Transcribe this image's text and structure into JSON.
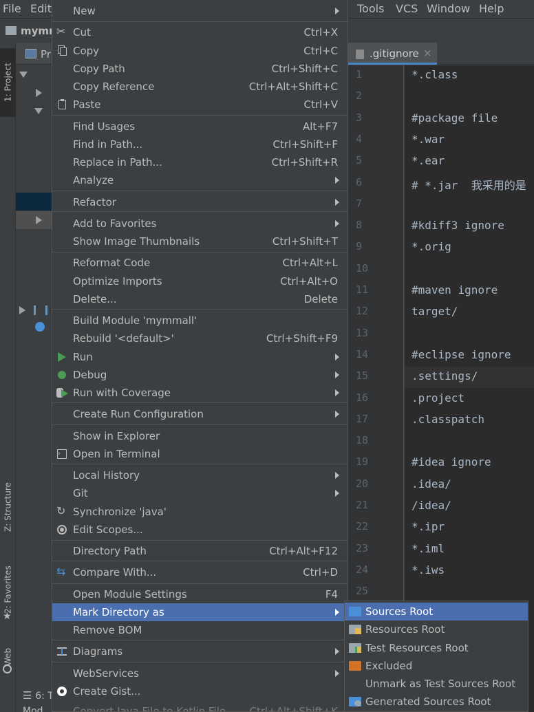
{
  "menubar": {
    "file": "File",
    "edit": "Edit",
    "tools": "Tools",
    "vcs": "VCS",
    "window": "Window",
    "help": "Help"
  },
  "navbar": {
    "project_name": "mymr"
  },
  "toolstrip": {
    "project": "1: Project",
    "structure": "Z: Structure",
    "favorites": "2: Favorites",
    "web": "Web"
  },
  "project_panel": {
    "title": "Pr"
  },
  "bottom": {
    "tab": "6: T",
    "cut_label": "Mod"
  },
  "editor": {
    "tab": ".gitignore",
    "tab_close": "×",
    "current_line": 15,
    "lines": [
      {
        "n": "1",
        "t": "*.class"
      },
      {
        "n": "2",
        "t": ""
      },
      {
        "n": "3",
        "t": "#package file"
      },
      {
        "n": "4",
        "t": "*.war"
      },
      {
        "n": "5",
        "t": "*.ear"
      },
      {
        "n": "6",
        "t": "# *.jar  我采用的是"
      },
      {
        "n": "7",
        "t": ""
      },
      {
        "n": "8",
        "t": "#kdiff3 ignore"
      },
      {
        "n": "9",
        "t": "*.orig"
      },
      {
        "n": "10",
        "t": ""
      },
      {
        "n": "11",
        "t": "#maven ignore"
      },
      {
        "n": "12",
        "t": "target/"
      },
      {
        "n": "13",
        "t": ""
      },
      {
        "n": "14",
        "t": "#eclipse ignore"
      },
      {
        "n": "15",
        "t": ".settings/"
      },
      {
        "n": "16",
        "t": ".project"
      },
      {
        "n": "17",
        "t": ".classpatch"
      },
      {
        "n": "18",
        "t": ""
      },
      {
        "n": "19",
        "t": "#idea ignore"
      },
      {
        "n": "20",
        "t": ".idea/"
      },
      {
        "n": "21",
        "t": "/idea/"
      },
      {
        "n": "22",
        "t": "*.ipr"
      },
      {
        "n": "23",
        "t": "*.iml"
      },
      {
        "n": "24",
        "t": "*.iws"
      },
      {
        "n": "25",
        "t": ""
      }
    ]
  },
  "context_menu": {
    "items": [
      {
        "label": "New",
        "shortcut": "",
        "submenu": true
      },
      {
        "label": "Cut",
        "shortcut": "Ctrl+X"
      },
      {
        "label": "Copy",
        "shortcut": "Ctrl+C"
      },
      {
        "label": "Copy Path",
        "shortcut": "Ctrl+Shift+C"
      },
      {
        "label": "Copy Reference",
        "shortcut": "Ctrl+Alt+Shift+C"
      },
      {
        "label": "Paste",
        "shortcut": "Ctrl+V"
      },
      {
        "label": "Find Usages",
        "shortcut": "Alt+F7"
      },
      {
        "label": "Find in Path...",
        "shortcut": "Ctrl+Shift+F"
      },
      {
        "label": "Replace in Path...",
        "shortcut": "Ctrl+Shift+R"
      },
      {
        "label": "Analyze",
        "shortcut": "",
        "submenu": true
      },
      {
        "label": "Refactor",
        "shortcut": "",
        "submenu": true
      },
      {
        "label": "Add to Favorites",
        "shortcut": "",
        "submenu": true
      },
      {
        "label": "Show Image Thumbnails",
        "shortcut": "Ctrl+Shift+T"
      },
      {
        "label": "Reformat Code",
        "shortcut": "Ctrl+Alt+L"
      },
      {
        "label": "Optimize Imports",
        "shortcut": "Ctrl+Alt+O"
      },
      {
        "label": "Delete...",
        "shortcut": "Delete"
      },
      {
        "label": "Build Module 'mymmall'",
        "shortcut": ""
      },
      {
        "label": "Rebuild '<default>'",
        "shortcut": "Ctrl+Shift+F9"
      },
      {
        "label": "Run",
        "shortcut": "",
        "submenu": true
      },
      {
        "label": "Debug",
        "shortcut": "",
        "submenu": true
      },
      {
        "label": "Run with Coverage",
        "shortcut": "",
        "submenu": true
      },
      {
        "label": "Create Run Configuration",
        "shortcut": "",
        "submenu": true
      },
      {
        "label": "Show in Explorer",
        "shortcut": ""
      },
      {
        "label": "Open in Terminal",
        "shortcut": ""
      },
      {
        "label": "Local History",
        "shortcut": "",
        "submenu": true
      },
      {
        "label": "Git",
        "shortcut": "",
        "submenu": true
      },
      {
        "label": "Synchronize 'java'",
        "shortcut": ""
      },
      {
        "label": "Edit Scopes...",
        "shortcut": ""
      },
      {
        "label": "Directory Path",
        "shortcut": "Ctrl+Alt+F12"
      },
      {
        "label": "Compare With...",
        "shortcut": "Ctrl+D"
      },
      {
        "label": "Open Module Settings",
        "shortcut": "F4"
      },
      {
        "label": "Mark Directory as",
        "shortcut": "",
        "submenu": true
      },
      {
        "label": "Remove BOM",
        "shortcut": ""
      },
      {
        "label": "Diagrams",
        "shortcut": "",
        "submenu": true
      },
      {
        "label": "WebServices",
        "shortcut": "",
        "submenu": true
      },
      {
        "label": "Create Gist...",
        "shortcut": ""
      },
      {
        "label": "Convert Java File to Kotlin File",
        "shortcut": "Ctrl+Alt+Shift+K"
      }
    ]
  },
  "submenu": {
    "items": [
      {
        "label": "Sources Root"
      },
      {
        "label": "Resources Root"
      },
      {
        "label": "Test Resources Root"
      },
      {
        "label": "Excluded"
      },
      {
        "label": "Unmark as Test Sources Root"
      },
      {
        "label": "Generated Sources Root"
      }
    ]
  },
  "colors": {
    "highlight": "#4b6eaf",
    "background": "#3c3f41",
    "editor_bg": "#2b2b2b",
    "folder_blue": "#4a90d9",
    "folder_orange": "#d3732a",
    "run_green": "#499c54"
  }
}
